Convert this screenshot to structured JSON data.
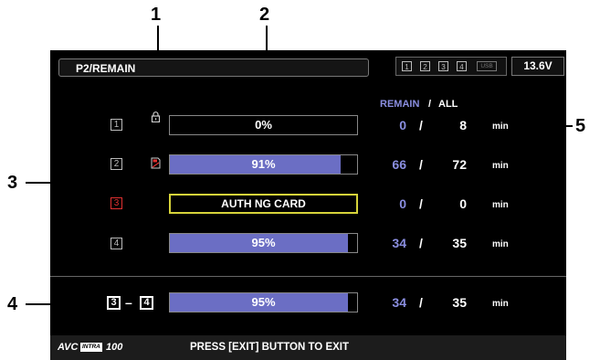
{
  "callouts": [
    "1",
    "2",
    "3",
    "4",
    "5"
  ],
  "header": {
    "title": "P2/REMAIN",
    "slot_icons": [
      "1",
      "2",
      "3",
      "4"
    ],
    "usb_label": "USB",
    "voltage": "13.6V"
  },
  "columns": {
    "remain_label": "REMAIN",
    "sep": "/",
    "all_label": "ALL"
  },
  "rows": [
    {
      "slot": "1",
      "bar_text": "0%",
      "fill_fraction": 0.0,
      "remain": "0",
      "sep": "/",
      "all": "8",
      "unit": "min"
    },
    {
      "slot": "2",
      "bar_text": "91%",
      "fill_fraction": 0.91,
      "remain": "66",
      "sep": "/",
      "all": "72",
      "unit": "min"
    },
    {
      "slot": "3",
      "bar_text": "AUTH NG CARD",
      "fill_fraction": 0.0,
      "remain": "0",
      "sep": "/",
      "all": "0",
      "unit": "min"
    },
    {
      "slot": "4",
      "bar_text": "95%",
      "fill_fraction": 0.95,
      "remain": "34",
      "sep": "/",
      "all": "35",
      "unit": "min"
    }
  ],
  "combined": {
    "slot_a": "3",
    "dash": "–",
    "slot_b": "4",
    "bar_text": "95%",
    "fill_fraction": 0.95,
    "remain": "34",
    "sep": "/",
    "all": "35",
    "unit": "min"
  },
  "footer": {
    "logo_text": "AVC",
    "logo_badge": "INTRA",
    "logo_num": "100",
    "message": "PRESS [EXIT] BUTTON TO EXIT"
  },
  "colors": {
    "remain_blue": "#8a8ee0",
    "bar_fill": "#6b6ec4",
    "warn_yellow": "#d6d33a",
    "error_red": "#e03030"
  }
}
